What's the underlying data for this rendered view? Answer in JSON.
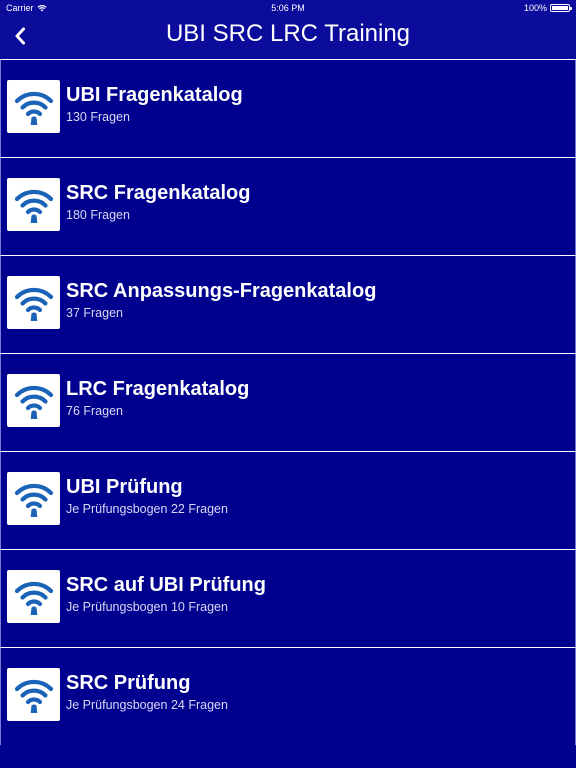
{
  "status_bar": {
    "carrier": "Carrier",
    "time": "5:06 PM",
    "battery": "100%",
    "battery_level": 1.0
  },
  "nav": {
    "back_icon": "chevron-left-icon",
    "title": "UBI SRC LRC Training"
  },
  "colors": {
    "background": "#00008f",
    "nav_background": "#0b0b9c",
    "icon_blue": "#1a63b8"
  },
  "items": [
    {
      "title": "UBI Fragenkatalog",
      "subtitle": "130 Fragen",
      "icon": "wifi-signal-icon"
    },
    {
      "title": "SRC Fragenkatalog",
      "subtitle": "180 Fragen",
      "icon": "wifi-signal-icon"
    },
    {
      "title": "SRC Anpassungs-Fragenkatalog",
      "subtitle": "37 Fragen",
      "icon": "wifi-signal-icon"
    },
    {
      "title": "LRC Fragenkatalog",
      "subtitle": "76 Fragen",
      "icon": "wifi-signal-icon"
    },
    {
      "title": "UBI Prüfung",
      "subtitle": "Je Prüfungsbogen 22 Fragen",
      "icon": "wifi-signal-icon"
    },
    {
      "title": "SRC auf UBI Prüfung",
      "subtitle": "Je Prüfungsbogen 10 Fragen",
      "icon": "wifi-signal-icon"
    },
    {
      "title": "SRC Prüfung",
      "subtitle": "Je Prüfungsbogen 24 Fragen",
      "icon": "wifi-signal-icon"
    }
  ]
}
